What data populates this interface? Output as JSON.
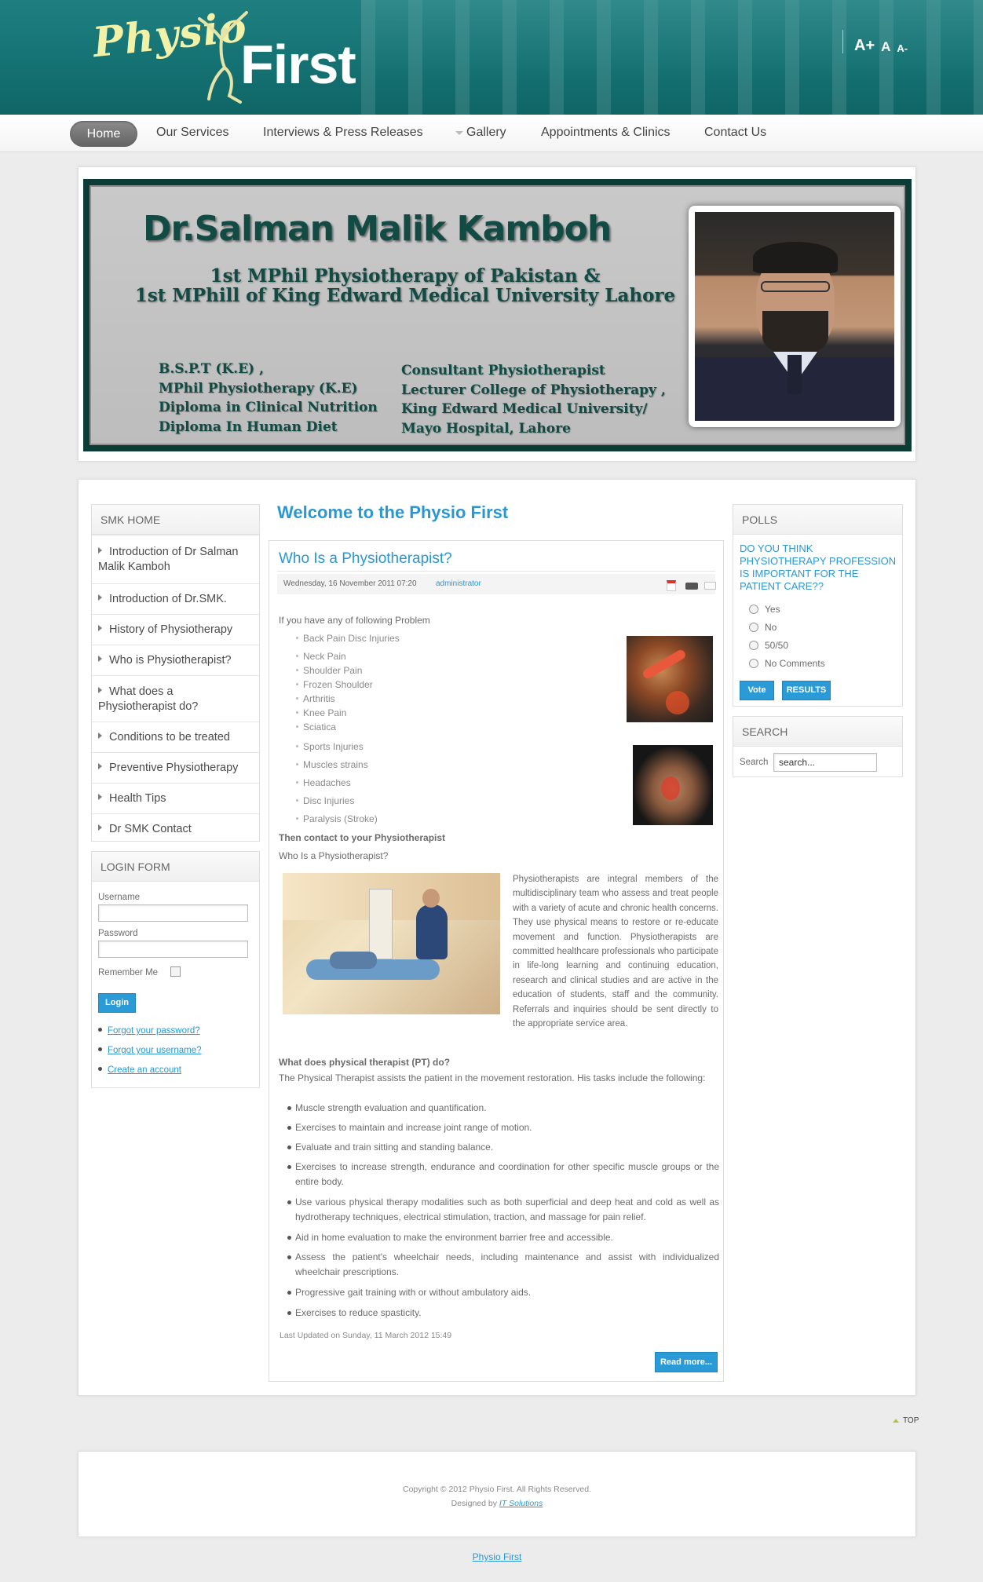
{
  "header": {
    "logo_physio": "Physio",
    "logo_first": "First",
    "font_tools": [
      "A+",
      "A",
      "A-"
    ]
  },
  "nav": {
    "items": [
      {
        "label": "Home"
      },
      {
        "label": "Our Services"
      },
      {
        "label": "Interviews & Press Releases"
      },
      {
        "label": "Gallery"
      },
      {
        "label": "Appointments & Clinics"
      },
      {
        "label": "Contact Us"
      }
    ]
  },
  "banner": {
    "name": "Dr.Salman Malik Kamboh",
    "line1": "1st MPhil Physiotherapy of Pakistan &",
    "line2": "1st MPhill of King Edward Medical University Lahore",
    "quals": [
      "B.S.P.T (K.E) ,",
      "MPhil Physiotherapy (K.E)",
      "Diploma in Clinical Nutrition",
      "Diploma In Human Diet"
    ],
    "roles": [
      "Consultant Physiotherapist",
      "Lecturer College of Physiotherapy ,",
      "King Edward Medical University/",
      "Mayo Hospital, Lahore"
    ]
  },
  "left": {
    "menu_title": "SMK HOME",
    "menu": [
      "Introduction of Dr Salman Malik Kamboh",
      "Introduction of Dr.SMK.",
      "History of Physiotherapy",
      "Who is Physiotherapist?",
      "What does a Physiotherapist do?",
      "Conditions to be treated",
      "Preventive Physiotherapy",
      "Health Tips",
      "Dr SMK Contact"
    ],
    "login_title": "LOGIN FORM",
    "username_label": "Username",
    "password_label": "Password",
    "remember_label": "Remember Me",
    "login_button": "Login",
    "links": [
      "Forgot your password?",
      "Forgot your username?",
      "Create an account"
    ]
  },
  "main": {
    "page_title": "Welcome to the Physio First",
    "article_title": "Who Is a Physiotherapist?",
    "date": "Wednesday, 16 November 2011 07:20",
    "author": "administrator",
    "intro": "If you have any of following Problem",
    "problems_a": [
      "Back Pain   Disc Injuries",
      "Neck Pain",
      "Shoulder Pain",
      "Frozen Shoulder",
      "Arthritis",
      "Knee Pain",
      "Sciatica"
    ],
    "problems_b": [
      "Sports Injuries",
      "Muscles strains",
      "Headaches",
      "Disc Injuries",
      "Paralysis (Stroke)"
    ],
    "contact_line": "Then contact to your Physiotherapist",
    "who_line": "Who Is a Physiotherapist?",
    "para": "Physiotherapists are integral members of the multidisciplinary team who assess and treat people with a variety of acute and chronic health concerns. They use physical means to restore or re-educate movement and function. Physiotherapists are committed healthcare professionals who participate in life-long learning and continuing education, research and clinical studies and are active in the education of students, staff and the community. Referrals and inquiries should be sent directly to the appropriate service area.",
    "pt_heading": "What does physical therapist (PT) do?",
    "pt_intro": "The Physical Therapist assists the patient in the movement restoration. His tasks include the following:",
    "tasks": [
      "Muscle strength evaluation and quantification.",
      "Exercises to maintain and increase joint range of motion.",
      "Evaluate and train sitting and standing balance.",
      "Exercises to increase strength, endurance and coordination for other specific muscle groups or the entire body.",
      "Use various physical therapy modalities such as both superficial and deep heat and cold as well as hydrotherapy techniques, electrical stimulation, traction, and massage for pain relief.",
      "Aid in home evaluation to make the environment barrier free and accessible.",
      "Assess the patient's wheelchair needs, including maintenance and assist with individualized wheelchair prescriptions.",
      "Progressive gait training with or without ambulatory aids.",
      "Exercises to reduce spasticity."
    ],
    "updated": "Last Updated on Sunday, 11 March 2012 15:49",
    "read_more": "Read more..."
  },
  "right": {
    "polls_title": "POLLS",
    "question": "DO YOU THINK PHYSIOTHERAPY PROFESSION IS IMPORTANT FOR THE PATIENT CARE??",
    "options": [
      "Yes",
      "No",
      "50/50",
      "No Comments"
    ],
    "vote_button": "Vote",
    "results_button": "RESULTS",
    "search_title": "SEARCH",
    "search_label": "Search",
    "search_value": "search..."
  },
  "footer": {
    "top_link": "TOP",
    "copyright": "Copyright © 2012 Physio First. All Rights Reserved.",
    "designed_by": "Designed by",
    "designer": "IT Solutions",
    "bottom_link": "Physio First"
  },
  "colors": {
    "header_teal": "#157273",
    "accent_blue": "#2b97d0",
    "button_blue": "#2a9bd6"
  }
}
